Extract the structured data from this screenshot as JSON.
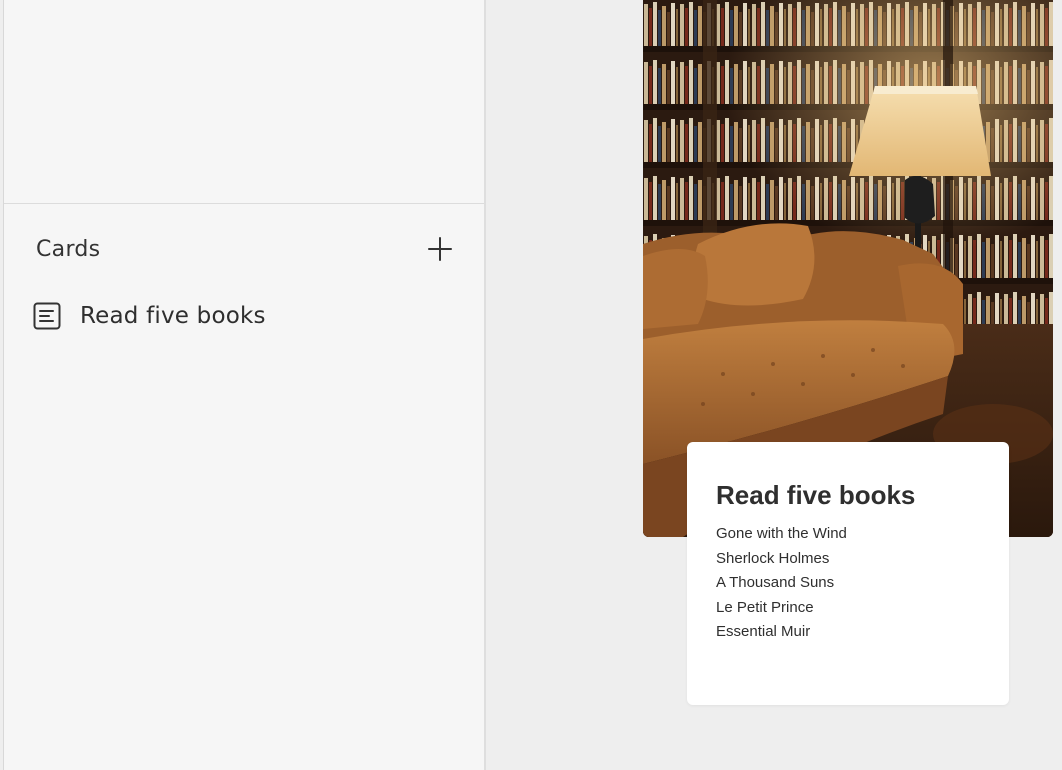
{
  "sidebar": {
    "section_title": "Cards",
    "add_icon": "plus-icon",
    "items": [
      {
        "label": "Read five books",
        "icon": "document-icon"
      }
    ]
  },
  "canvas": {
    "photo": {
      "subject": "library-room-with-leather-sofa",
      "accent_colors": [
        "#3a2516",
        "#b8773a",
        "#e8c48a"
      ]
    },
    "card": {
      "title": "Read five books",
      "lines": [
        "Gone with the Wind",
        "Sherlock Holmes",
        "A Thousand Suns",
        "Le Petit Prince",
        "Essential Muir"
      ]
    }
  }
}
